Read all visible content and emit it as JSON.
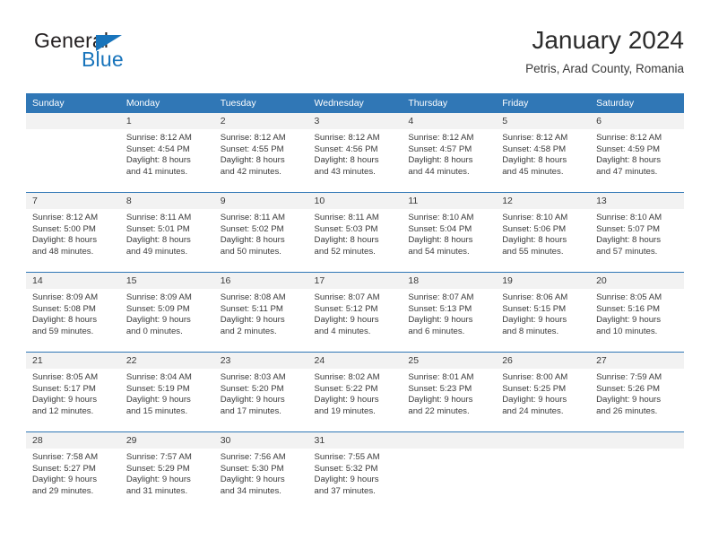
{
  "brand": {
    "name_part1": "General",
    "name_part2": "Blue",
    "triangle_color": "#1874bb"
  },
  "header": {
    "title": "January 2024",
    "subtitle": "Petris, Arad County, Romania"
  },
  "theme": {
    "header_blue": "#3077b6",
    "daynum_gray": "#f2f2f2",
    "text": "#3a3a3a"
  },
  "weekdays": [
    "Sunday",
    "Monday",
    "Tuesday",
    "Wednesday",
    "Thursday",
    "Friday",
    "Saturday"
  ],
  "weeks": [
    [
      {
        "day": "",
        "sunrise": "",
        "sunset": "",
        "daylight_line1": "",
        "daylight_line2": ""
      },
      {
        "day": "1",
        "sunrise": "Sunrise: 8:12 AM",
        "sunset": "Sunset: 4:54 PM",
        "daylight_line1": "Daylight: 8 hours",
        "daylight_line2": "and 41 minutes."
      },
      {
        "day": "2",
        "sunrise": "Sunrise: 8:12 AM",
        "sunset": "Sunset: 4:55 PM",
        "daylight_line1": "Daylight: 8 hours",
        "daylight_line2": "and 42 minutes."
      },
      {
        "day": "3",
        "sunrise": "Sunrise: 8:12 AM",
        "sunset": "Sunset: 4:56 PM",
        "daylight_line1": "Daylight: 8 hours",
        "daylight_line2": "and 43 minutes."
      },
      {
        "day": "4",
        "sunrise": "Sunrise: 8:12 AM",
        "sunset": "Sunset: 4:57 PM",
        "daylight_line1": "Daylight: 8 hours",
        "daylight_line2": "and 44 minutes."
      },
      {
        "day": "5",
        "sunrise": "Sunrise: 8:12 AM",
        "sunset": "Sunset: 4:58 PM",
        "daylight_line1": "Daylight: 8 hours",
        "daylight_line2": "and 45 minutes."
      },
      {
        "day": "6",
        "sunrise": "Sunrise: 8:12 AM",
        "sunset": "Sunset: 4:59 PM",
        "daylight_line1": "Daylight: 8 hours",
        "daylight_line2": "and 47 minutes."
      }
    ],
    [
      {
        "day": "7",
        "sunrise": "Sunrise: 8:12 AM",
        "sunset": "Sunset: 5:00 PM",
        "daylight_line1": "Daylight: 8 hours",
        "daylight_line2": "and 48 minutes."
      },
      {
        "day": "8",
        "sunrise": "Sunrise: 8:11 AM",
        "sunset": "Sunset: 5:01 PM",
        "daylight_line1": "Daylight: 8 hours",
        "daylight_line2": "and 49 minutes."
      },
      {
        "day": "9",
        "sunrise": "Sunrise: 8:11 AM",
        "sunset": "Sunset: 5:02 PM",
        "daylight_line1": "Daylight: 8 hours",
        "daylight_line2": "and 50 minutes."
      },
      {
        "day": "10",
        "sunrise": "Sunrise: 8:11 AM",
        "sunset": "Sunset: 5:03 PM",
        "daylight_line1": "Daylight: 8 hours",
        "daylight_line2": "and 52 minutes."
      },
      {
        "day": "11",
        "sunrise": "Sunrise: 8:10 AM",
        "sunset": "Sunset: 5:04 PM",
        "daylight_line1": "Daylight: 8 hours",
        "daylight_line2": "and 54 minutes."
      },
      {
        "day": "12",
        "sunrise": "Sunrise: 8:10 AM",
        "sunset": "Sunset: 5:06 PM",
        "daylight_line1": "Daylight: 8 hours",
        "daylight_line2": "and 55 minutes."
      },
      {
        "day": "13",
        "sunrise": "Sunrise: 8:10 AM",
        "sunset": "Sunset: 5:07 PM",
        "daylight_line1": "Daylight: 8 hours",
        "daylight_line2": "and 57 minutes."
      }
    ],
    [
      {
        "day": "14",
        "sunrise": "Sunrise: 8:09 AM",
        "sunset": "Sunset: 5:08 PM",
        "daylight_line1": "Daylight: 8 hours",
        "daylight_line2": "and 59 minutes."
      },
      {
        "day": "15",
        "sunrise": "Sunrise: 8:09 AM",
        "sunset": "Sunset: 5:09 PM",
        "daylight_line1": "Daylight: 9 hours",
        "daylight_line2": "and 0 minutes."
      },
      {
        "day": "16",
        "sunrise": "Sunrise: 8:08 AM",
        "sunset": "Sunset: 5:11 PM",
        "daylight_line1": "Daylight: 9 hours",
        "daylight_line2": "and 2 minutes."
      },
      {
        "day": "17",
        "sunrise": "Sunrise: 8:07 AM",
        "sunset": "Sunset: 5:12 PM",
        "daylight_line1": "Daylight: 9 hours",
        "daylight_line2": "and 4 minutes."
      },
      {
        "day": "18",
        "sunrise": "Sunrise: 8:07 AM",
        "sunset": "Sunset: 5:13 PM",
        "daylight_line1": "Daylight: 9 hours",
        "daylight_line2": "and 6 minutes."
      },
      {
        "day": "19",
        "sunrise": "Sunrise: 8:06 AM",
        "sunset": "Sunset: 5:15 PM",
        "daylight_line1": "Daylight: 9 hours",
        "daylight_line2": "and 8 minutes."
      },
      {
        "day": "20",
        "sunrise": "Sunrise: 8:05 AM",
        "sunset": "Sunset: 5:16 PM",
        "daylight_line1": "Daylight: 9 hours",
        "daylight_line2": "and 10 minutes."
      }
    ],
    [
      {
        "day": "21",
        "sunrise": "Sunrise: 8:05 AM",
        "sunset": "Sunset: 5:17 PM",
        "daylight_line1": "Daylight: 9 hours",
        "daylight_line2": "and 12 minutes."
      },
      {
        "day": "22",
        "sunrise": "Sunrise: 8:04 AM",
        "sunset": "Sunset: 5:19 PM",
        "daylight_line1": "Daylight: 9 hours",
        "daylight_line2": "and 15 minutes."
      },
      {
        "day": "23",
        "sunrise": "Sunrise: 8:03 AM",
        "sunset": "Sunset: 5:20 PM",
        "daylight_line1": "Daylight: 9 hours",
        "daylight_line2": "and 17 minutes."
      },
      {
        "day": "24",
        "sunrise": "Sunrise: 8:02 AM",
        "sunset": "Sunset: 5:22 PM",
        "daylight_line1": "Daylight: 9 hours",
        "daylight_line2": "and 19 minutes."
      },
      {
        "day": "25",
        "sunrise": "Sunrise: 8:01 AM",
        "sunset": "Sunset: 5:23 PM",
        "daylight_line1": "Daylight: 9 hours",
        "daylight_line2": "and 22 minutes."
      },
      {
        "day": "26",
        "sunrise": "Sunrise: 8:00 AM",
        "sunset": "Sunset: 5:25 PM",
        "daylight_line1": "Daylight: 9 hours",
        "daylight_line2": "and 24 minutes."
      },
      {
        "day": "27",
        "sunrise": "Sunrise: 7:59 AM",
        "sunset": "Sunset: 5:26 PM",
        "daylight_line1": "Daylight: 9 hours",
        "daylight_line2": "and 26 minutes."
      }
    ],
    [
      {
        "day": "28",
        "sunrise": "Sunrise: 7:58 AM",
        "sunset": "Sunset: 5:27 PM",
        "daylight_line1": "Daylight: 9 hours",
        "daylight_line2": "and 29 minutes."
      },
      {
        "day": "29",
        "sunrise": "Sunrise: 7:57 AM",
        "sunset": "Sunset: 5:29 PM",
        "daylight_line1": "Daylight: 9 hours",
        "daylight_line2": "and 31 minutes."
      },
      {
        "day": "30",
        "sunrise": "Sunrise: 7:56 AM",
        "sunset": "Sunset: 5:30 PM",
        "daylight_line1": "Daylight: 9 hours",
        "daylight_line2": "and 34 minutes."
      },
      {
        "day": "31",
        "sunrise": "Sunrise: 7:55 AM",
        "sunset": "Sunset: 5:32 PM",
        "daylight_line1": "Daylight: 9 hours",
        "daylight_line2": "and 37 minutes."
      },
      {
        "day": "",
        "sunrise": "",
        "sunset": "",
        "daylight_line1": "",
        "daylight_line2": ""
      },
      {
        "day": "",
        "sunrise": "",
        "sunset": "",
        "daylight_line1": "",
        "daylight_line2": ""
      },
      {
        "day": "",
        "sunrise": "",
        "sunset": "",
        "daylight_line1": "",
        "daylight_line2": ""
      }
    ]
  ]
}
